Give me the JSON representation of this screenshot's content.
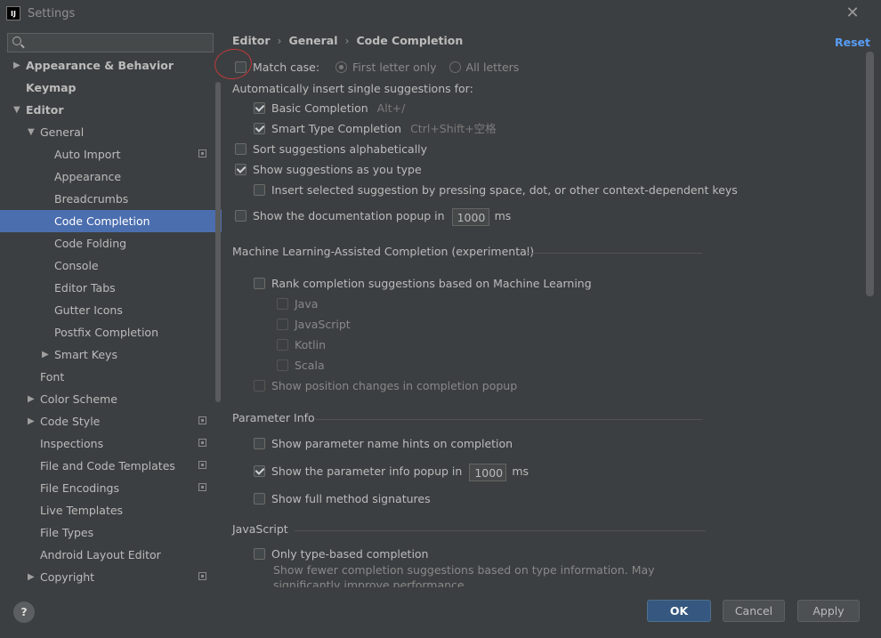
{
  "window": {
    "title": "Settings",
    "app_icon": "IJ"
  },
  "search": {
    "value": "",
    "placeholder": ""
  },
  "sidebar": {
    "items": [
      {
        "label": "Appearance & Behavior",
        "level": 0,
        "bold": true,
        "arrow": "▶"
      },
      {
        "label": "Keymap",
        "level": 0,
        "bold": true,
        "arrow": ""
      },
      {
        "label": "Editor",
        "level": 0,
        "bold": true,
        "arrow": "▼"
      },
      {
        "label": "General",
        "level": 1,
        "arrow": "▼"
      },
      {
        "label": "Auto Import",
        "level": 2,
        "arrow": "",
        "project_icon": true
      },
      {
        "label": "Appearance",
        "level": 2,
        "arrow": ""
      },
      {
        "label": "Breadcrumbs",
        "level": 2,
        "arrow": ""
      },
      {
        "label": "Code Completion",
        "level": 2,
        "arrow": "",
        "selected": true
      },
      {
        "label": "Code Folding",
        "level": 2,
        "arrow": ""
      },
      {
        "label": "Console",
        "level": 2,
        "arrow": ""
      },
      {
        "label": "Editor Tabs",
        "level": 2,
        "arrow": ""
      },
      {
        "label": "Gutter Icons",
        "level": 2,
        "arrow": ""
      },
      {
        "label": "Postfix Completion",
        "level": 2,
        "arrow": ""
      },
      {
        "label": "Smart Keys",
        "level": 2,
        "arrow": "▶"
      },
      {
        "label": "Font",
        "level": 1,
        "arrow": ""
      },
      {
        "label": "Color Scheme",
        "level": 1,
        "arrow": "▶"
      },
      {
        "label": "Code Style",
        "level": 1,
        "arrow": "▶",
        "project_icon": true
      },
      {
        "label": "Inspections",
        "level": 1,
        "arrow": "",
        "project_icon": true
      },
      {
        "label": "File and Code Templates",
        "level": 1,
        "arrow": "",
        "project_icon": true
      },
      {
        "label": "File Encodings",
        "level": 1,
        "arrow": "",
        "project_icon": true
      },
      {
        "label": "Live Templates",
        "level": 1,
        "arrow": ""
      },
      {
        "label": "File Types",
        "level": 1,
        "arrow": ""
      },
      {
        "label": "Android Layout Editor",
        "level": 1,
        "arrow": ""
      },
      {
        "label": "Copyright",
        "level": 1,
        "arrow": "▶",
        "project_icon": true
      }
    ]
  },
  "breadcrumb": {
    "part1": "Editor",
    "part2": "General",
    "part3": "Code Completion",
    "sep": "›"
  },
  "reset_label": "Reset",
  "options": {
    "match_case": "Match case:",
    "first_letter": "First letter only",
    "all_letters": "All letters",
    "auto_insert": "Automatically insert single suggestions for:",
    "basic_completion": "Basic Completion",
    "basic_shortcut": "Alt+/",
    "smart_completion": "Smart Type Completion",
    "smart_shortcut": "Ctrl+Shift+空格",
    "sort_alpha": "Sort suggestions alphabetically",
    "show_as_type": "Show suggestions as you type",
    "insert_selected": "Insert selected suggestion by pressing space, dot, or other context-dependent keys",
    "show_doc_popup": "Show the documentation popup in",
    "doc_popup_ms": "1000",
    "ms": "ms"
  },
  "ml": {
    "header": "Machine Learning-Assisted Completion (experimental)",
    "rank": "Rank completion suggestions based on Machine Learning",
    "languages": [
      "Java",
      "JavaScript",
      "Kotlin",
      "Scala"
    ],
    "show_position": "Show position changes in completion popup"
  },
  "param_info": {
    "header": "Parameter Info",
    "name_hints": "Show parameter name hints on completion",
    "info_popup": "Show the parameter info popup in",
    "info_popup_ms": "1000",
    "ms": "ms",
    "full_signatures": "Show full method signatures"
  },
  "javascript": {
    "header": "JavaScript",
    "type_based": "Only type-based completion",
    "desc_line1": "Show fewer completion suggestions based on type information. May",
    "desc_line2": "significantly improve performance."
  },
  "footer": {
    "help": "?",
    "ok": "OK",
    "cancel": "Cancel",
    "apply": "Apply"
  },
  "colors": {
    "selection": "#4b6eaf",
    "link": "#589df6",
    "annotation": "#c0393b",
    "primary_button": "#365880"
  }
}
